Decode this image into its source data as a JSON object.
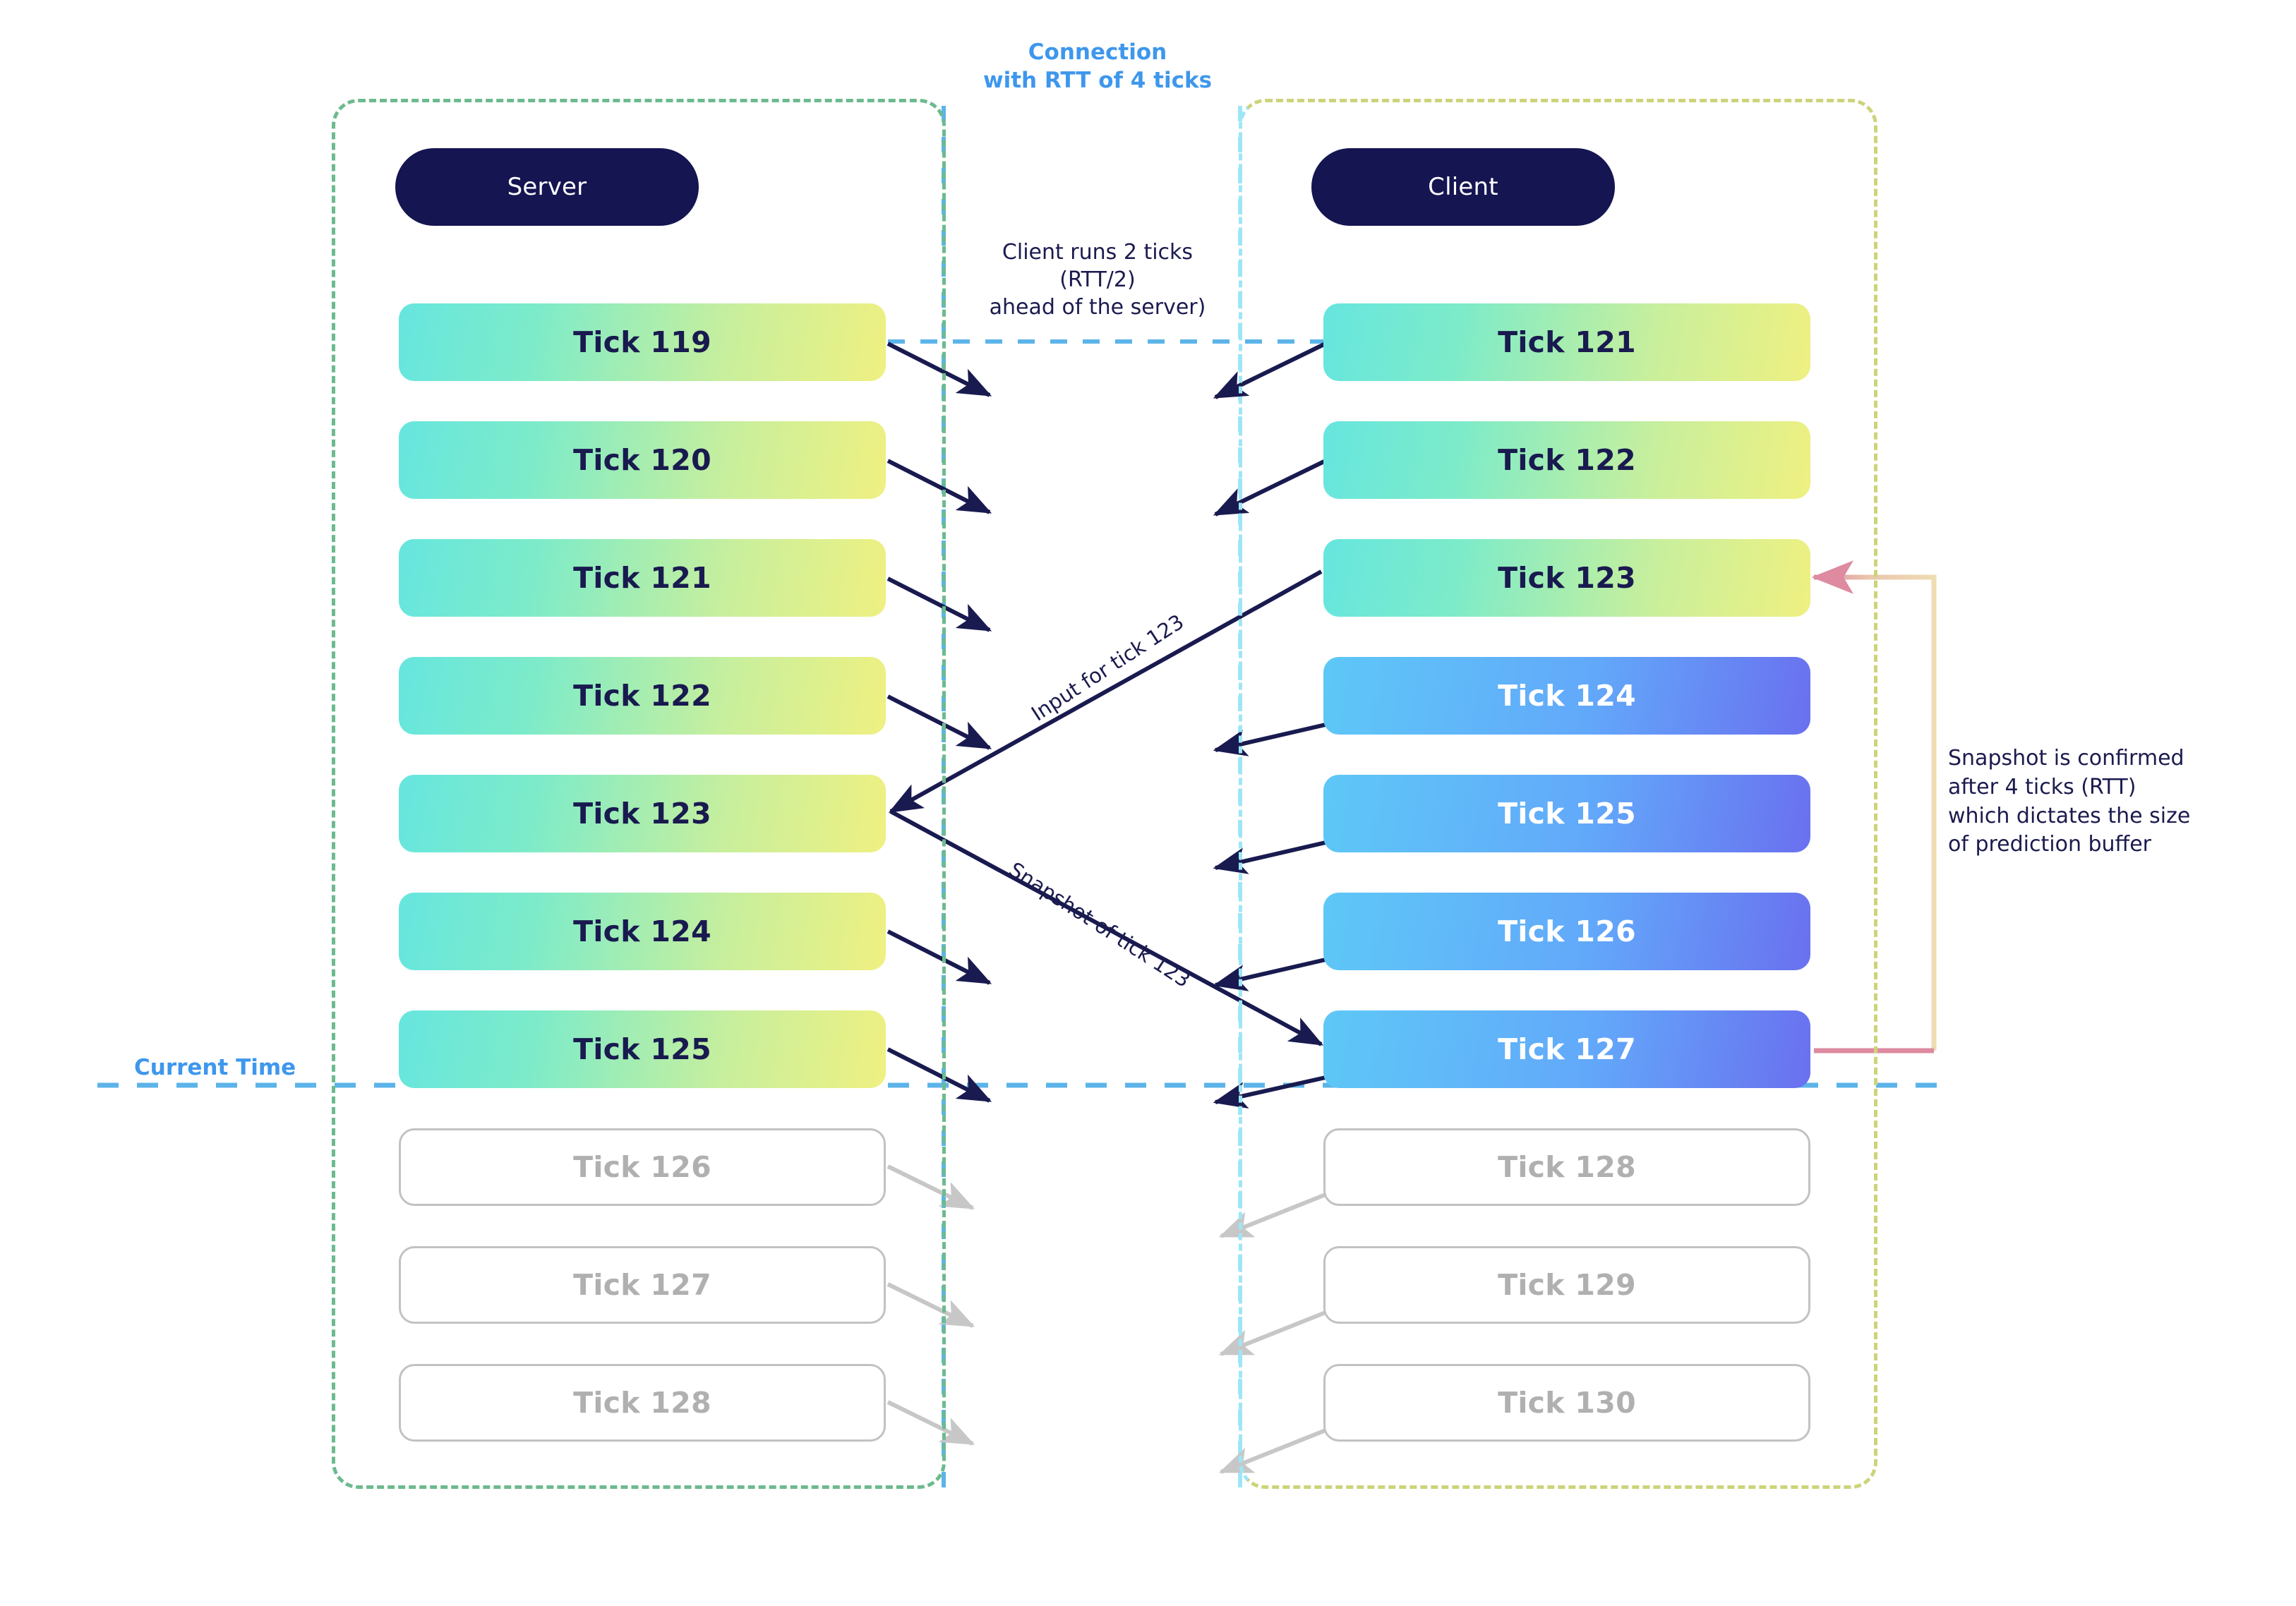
{
  "diagram": {
    "title_annotation": {
      "line1": "Connection",
      "line2": "with RTT of 4 ticks"
    },
    "center_annotation": {
      "line1": "Client runs 2 ticks",
      "line2": "(RTT/2)",
      "line3": "ahead of the server)"
    },
    "right_annotation": {
      "line1": "Snapshot is confirmed",
      "line2": "after 4 ticks (RTT)",
      "line3": "which dictates the size",
      "line4": "of prediction buffer"
    },
    "current_time_label": "Current Time",
    "arrow_labels": {
      "input": "Input for tick 123",
      "snapshot": "Snapshot of tick 123"
    }
  },
  "server": {
    "badge_label": "Server",
    "ticks": [
      {
        "label": "Tick 119",
        "state": "past"
      },
      {
        "label": "Tick 120",
        "state": "past"
      },
      {
        "label": "Tick 121",
        "state": "past"
      },
      {
        "label": "Tick 122",
        "state": "past"
      },
      {
        "label": "Tick 123",
        "state": "past"
      },
      {
        "label": "Tick 124",
        "state": "past"
      },
      {
        "label": "Tick 125",
        "state": "past"
      },
      {
        "label": "Tick 126",
        "state": "future"
      },
      {
        "label": "Tick 127",
        "state": "future"
      },
      {
        "label": "Tick 128",
        "state": "future"
      }
    ]
  },
  "client": {
    "badge_label": "Client",
    "ticks": [
      {
        "label": "Tick 121",
        "state": "past"
      },
      {
        "label": "Tick 122",
        "state": "past"
      },
      {
        "label": "Tick 123",
        "state": "past"
      },
      {
        "label": "Tick 124",
        "state": "predicted"
      },
      {
        "label": "Tick 125",
        "state": "predicted"
      },
      {
        "label": "Tick 126",
        "state": "predicted"
      },
      {
        "label": "Tick 127",
        "state": "predicted"
      },
      {
        "label": "Tick 128",
        "state": "future"
      },
      {
        "label": "Tick 129",
        "state": "future"
      },
      {
        "label": "Tick 130",
        "state": "future"
      }
    ]
  },
  "colors": {
    "accent_blue": "#3e97ec",
    "badge_navy": "#151552",
    "text_navy": "#1b1b4f",
    "server_pane_border": "#6cba8e",
    "client_pane_border": "#cdd37a",
    "client_pane_border_left": "#9ee6f5",
    "past_gradient_start": "#66e6df",
    "past_gradient_end": "#eff081",
    "predicted_gradient_start": "#5ec8f7",
    "predicted_gradient_end": "#6a70ef",
    "future_border": "#c2c2c2",
    "future_text": "#b0b0b0",
    "bracket_pink": "#e0899f",
    "bracket_tan": "#eed9ac",
    "arrow_navy": "#191a4f",
    "arrow_gray": "#c7c7c7",
    "dashed_blue": "#5cb4e8",
    "dashed_cyan": "#9ee6f5"
  }
}
